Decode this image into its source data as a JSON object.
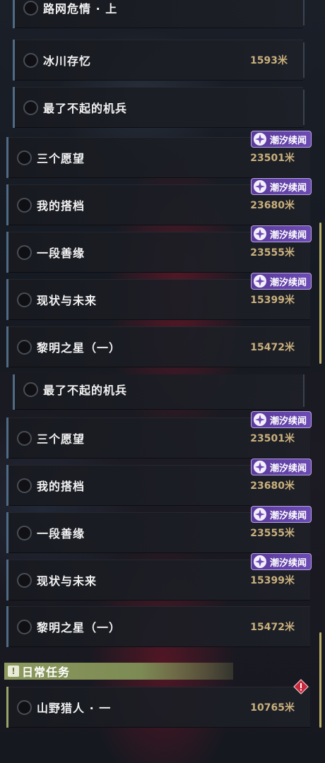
{
  "colors": {
    "card_border": "#4f6b86",
    "distance_text": "#c9b07c",
    "badge_purple": "#6c4bb4",
    "section_green": "#8c9a5e",
    "scrollbar": "#b8b06a",
    "alert_red": "#c8283c"
  },
  "icons": {
    "checkbox": "circle-checkbox-icon",
    "badge": "sparkle-star-icon",
    "section": "exclamation-icon",
    "alert": "diamond-alert-icon"
  },
  "top_list": {
    "rows": [
      {
        "name": "路网危情 · 上",
        "distance": "",
        "badge": ""
      },
      {
        "name": "冰川存忆",
        "distance": "1593米",
        "badge": ""
      },
      {
        "name": "最了不起的机兵",
        "distance": "",
        "badge": ""
      },
      {
        "name": "三个愿望",
        "distance": "23501米",
        "badge": "潮汐续闻"
      },
      {
        "name": "我的搭档",
        "distance": "23680米",
        "badge": "潮汐续闻"
      },
      {
        "name": "一段善缘",
        "distance": "23555米",
        "badge": "潮汐续闻"
      },
      {
        "name": "现状与未来",
        "distance": "15399米",
        "badge": "潮汐续闻"
      },
      {
        "name": "黎明之星（一）",
        "distance": "15472米",
        "badge": ""
      }
    ]
  },
  "bottom_list": {
    "rows": [
      {
        "name": "最了不起的机兵",
        "distance": "",
        "badge": ""
      },
      {
        "name": "三个愿望",
        "distance": "23501米",
        "badge": "潮汐续闻"
      },
      {
        "name": "我的搭档",
        "distance": "23680米",
        "badge": "潮汐续闻"
      },
      {
        "name": "一段善缘",
        "distance": "23555米",
        "badge": "潮汐续闻"
      },
      {
        "name": "现状与未来",
        "distance": "15399米",
        "badge": "潮汐续闻"
      },
      {
        "name": "黎明之星（一）",
        "distance": "15472米",
        "badge": ""
      }
    ],
    "section_title": "日常任务",
    "daily_rows": [
      {
        "name": "山野猎人 · 一",
        "distance": "10765米"
      }
    ]
  }
}
